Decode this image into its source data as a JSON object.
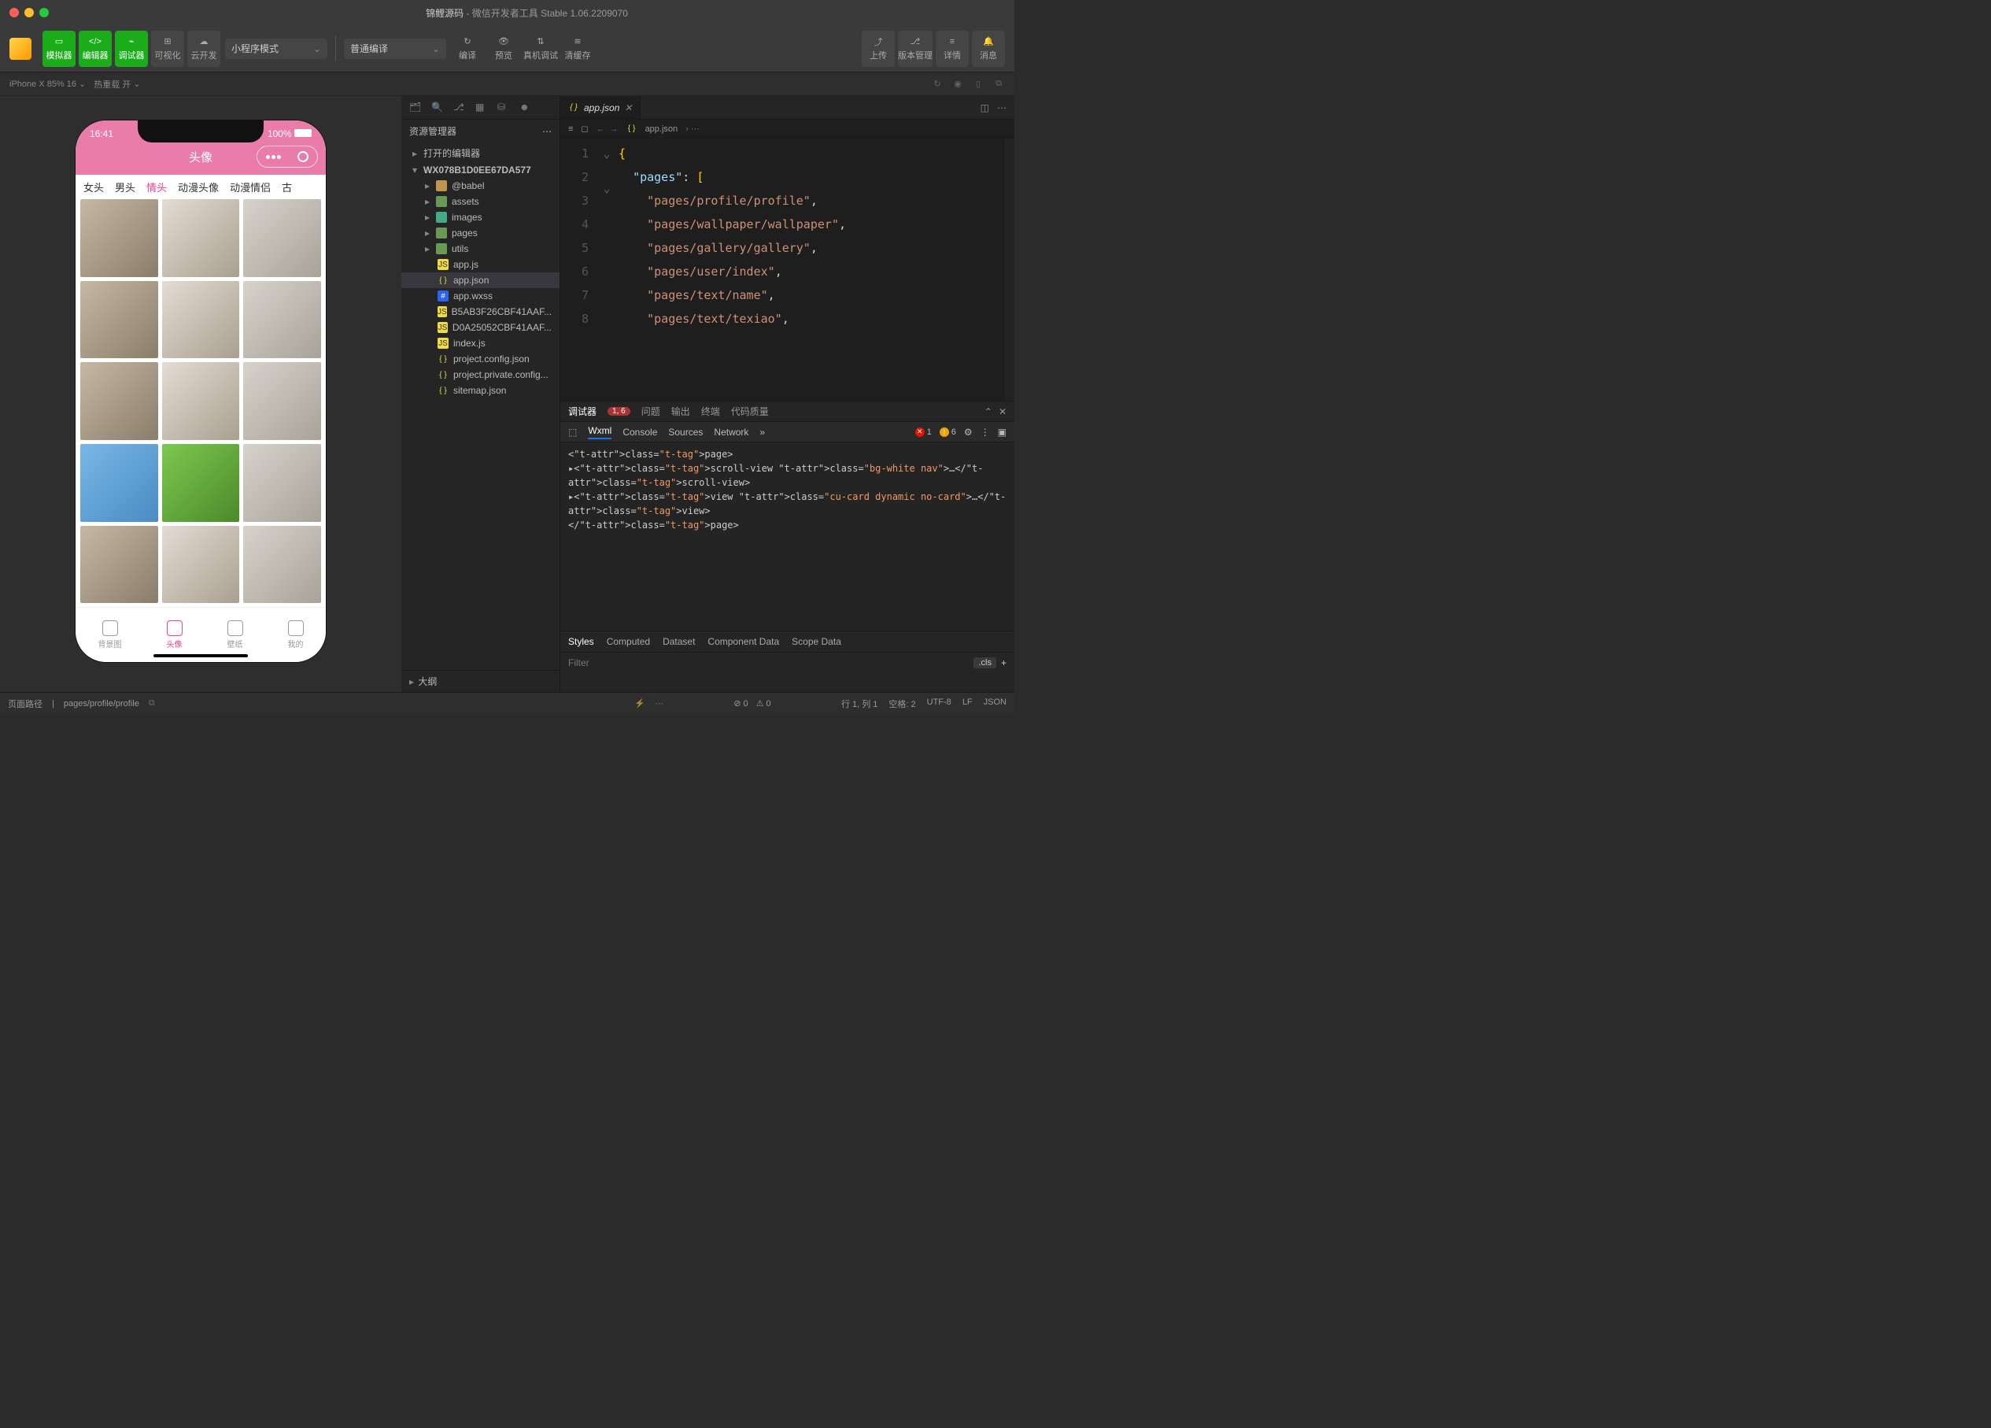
{
  "window": {
    "title_prefix": "锦鲤源码",
    "title_suffix": " - 微信开发者工具 Stable 1.06.2209070"
  },
  "toolbar": {
    "simulator": "模拟器",
    "editor": "编辑器",
    "debugger": "调试器",
    "visual": "可视化",
    "cloud": "云开发",
    "mode": "小程序模式",
    "compile_mode": "普通编译",
    "compile": "编译",
    "preview": "预览",
    "remote_debug": "真机调试",
    "clear_cache": "清缓存",
    "upload": "上传",
    "version": "版本管理",
    "details": "详情",
    "messages": "消息"
  },
  "subbar": {
    "device": "iPhone X 85% 16",
    "hot_reload": "热重载 开"
  },
  "explorer": {
    "title": "资源管理器",
    "open_editors": "打开的编辑器",
    "project": "WX078B1D0EE67DA577",
    "folders": [
      "@babel",
      "assets",
      "images",
      "pages",
      "utils"
    ],
    "files": [
      {
        "name": "app.js",
        "type": "js"
      },
      {
        "name": "app.json",
        "type": "json",
        "selected": true
      },
      {
        "name": "app.wxss",
        "type": "wxss"
      },
      {
        "name": "B5AB3F26CBF41AAF...",
        "type": "js"
      },
      {
        "name": "D0A25052CBF41AAF...",
        "type": "js"
      },
      {
        "name": "index.js",
        "type": "js"
      },
      {
        "name": "project.config.json",
        "type": "json"
      },
      {
        "name": "project.private.config...",
        "type": "json"
      },
      {
        "name": "sitemap.json",
        "type": "json"
      }
    ],
    "outline": "大纲"
  },
  "editor": {
    "tab_name": "app.json",
    "breadcrumb": "app.json",
    "lines": [
      "{",
      "  \"pages\": [",
      "    \"pages/profile/profile\",",
      "    \"pages/wallpaper/wallpaper\",",
      "    \"pages/gallery/gallery\",",
      "    \"pages/user/index\",",
      "    \"pages/text/name\",",
      "    \"pages/text/texiao\","
    ]
  },
  "debugger": {
    "tabs": {
      "main": "调试器",
      "badge": "1, 6",
      "problems": "问题",
      "output": "输出",
      "terminal": "终端",
      "quality": "代码质量"
    },
    "devtools": {
      "wxml": "Wxml",
      "console": "Console",
      "sources": "Sources",
      "network": "Network",
      "err": "1",
      "warn": "6"
    },
    "dom_lines": [
      "<page>",
      "▸<scroll-view class=\"bg-white nav\">…</scroll-view>",
      "▸<view class=\"cu-card dynamic no-card\">…</view>",
      "</page>"
    ],
    "styles": {
      "tabs": [
        "Styles",
        "Computed",
        "Dataset",
        "Component Data",
        "Scope Data"
      ],
      "filter_ph": "Filter",
      "cls": ".cls"
    }
  },
  "simulator": {
    "time": "16:41",
    "battery": "100%",
    "title": "头像",
    "tabs": [
      "女头",
      "男头",
      "情头",
      "动漫头像",
      "动漫情侣",
      "古"
    ],
    "tab_active_index": 2,
    "bottom_tabs": [
      {
        "label": "背景图"
      },
      {
        "label": "头像",
        "active": true
      },
      {
        "label": "壁纸"
      },
      {
        "label": "我的"
      }
    ]
  },
  "statusbar": {
    "page_path_label": "页面路径",
    "page_path": "pages/profile/profile",
    "errors": "0",
    "warnings": "0",
    "line_col": "行 1, 列 1",
    "spaces": "空格: 2",
    "encoding": "UTF-8",
    "eol": "LF",
    "lang": "JSON"
  }
}
